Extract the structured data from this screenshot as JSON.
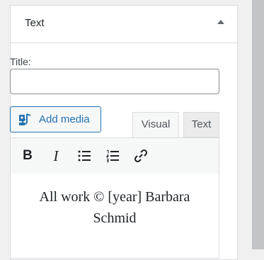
{
  "widget": {
    "title": "Text",
    "title_field_label": "Title:",
    "title_field_value": ""
  },
  "media": {
    "add_media_label": "Add media",
    "icon": "add-media-icon"
  },
  "tabs": [
    {
      "label": "Visual",
      "active": true
    },
    {
      "label": "Text",
      "active": false
    }
  ],
  "toolbar": {
    "buttons": [
      "bold-icon",
      "italic-icon",
      "bullet-list-icon",
      "numbered-list-icon",
      "link-icon"
    ]
  },
  "editor": {
    "content": "All work © [year] Barbara Schmid"
  },
  "colors": {
    "accent": "#2271b1",
    "border": "#dcdcde",
    "input_border": "#8c8f94"
  }
}
